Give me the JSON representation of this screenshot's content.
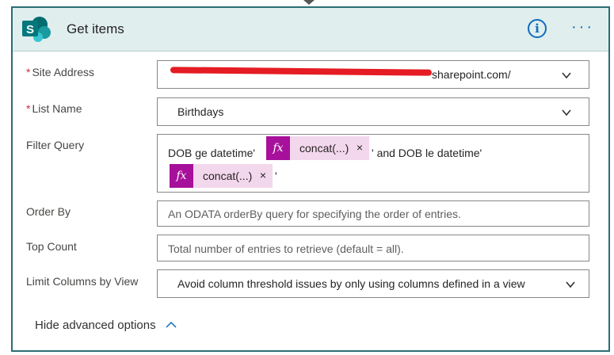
{
  "header": {
    "title": "Get items",
    "logo_letter": "S",
    "info_symbol": "i",
    "more_symbol": "···",
    "colors": {
      "band": "#e0eeee",
      "border": "#2b6d73",
      "accent": "#0f6cbd",
      "sharepoint": "#03787c"
    }
  },
  "fields": {
    "site_address": {
      "required_mark": "*",
      "label": "Site Address",
      "value_visible": "sharepoint.com/",
      "redacted": true
    },
    "list_name": {
      "required_mark": "*",
      "label": "List Name",
      "value": "Birthdays"
    },
    "filter_query": {
      "label": "Filter Query",
      "text1": "DOB ge  datetime'",
      "token1": {
        "icon": "fx",
        "label": "concat(...)",
        "remove": "×"
      },
      "text2": "' and DOB le datetime'",
      "token2": {
        "icon": "fx",
        "label": "concat(...)",
        "remove": "×"
      },
      "text3": "'"
    },
    "order_by": {
      "label": "Order By",
      "placeholder": "An ODATA orderBy query for specifying the order of entries."
    },
    "top_count": {
      "label": "Top Count",
      "placeholder": "Total number of entries to retrieve (default = all)."
    },
    "limit_columns": {
      "label": "Limit Columns by View",
      "value": "Avoid column threshold issues by only using columns defined in a view"
    }
  },
  "footer": {
    "hide_advanced_label": "Hide advanced options"
  },
  "colors": {
    "token_bg": "#f3d7ec",
    "token_icon": "#a7109a",
    "required": "#c4314b",
    "redaction": "#e51c23"
  }
}
